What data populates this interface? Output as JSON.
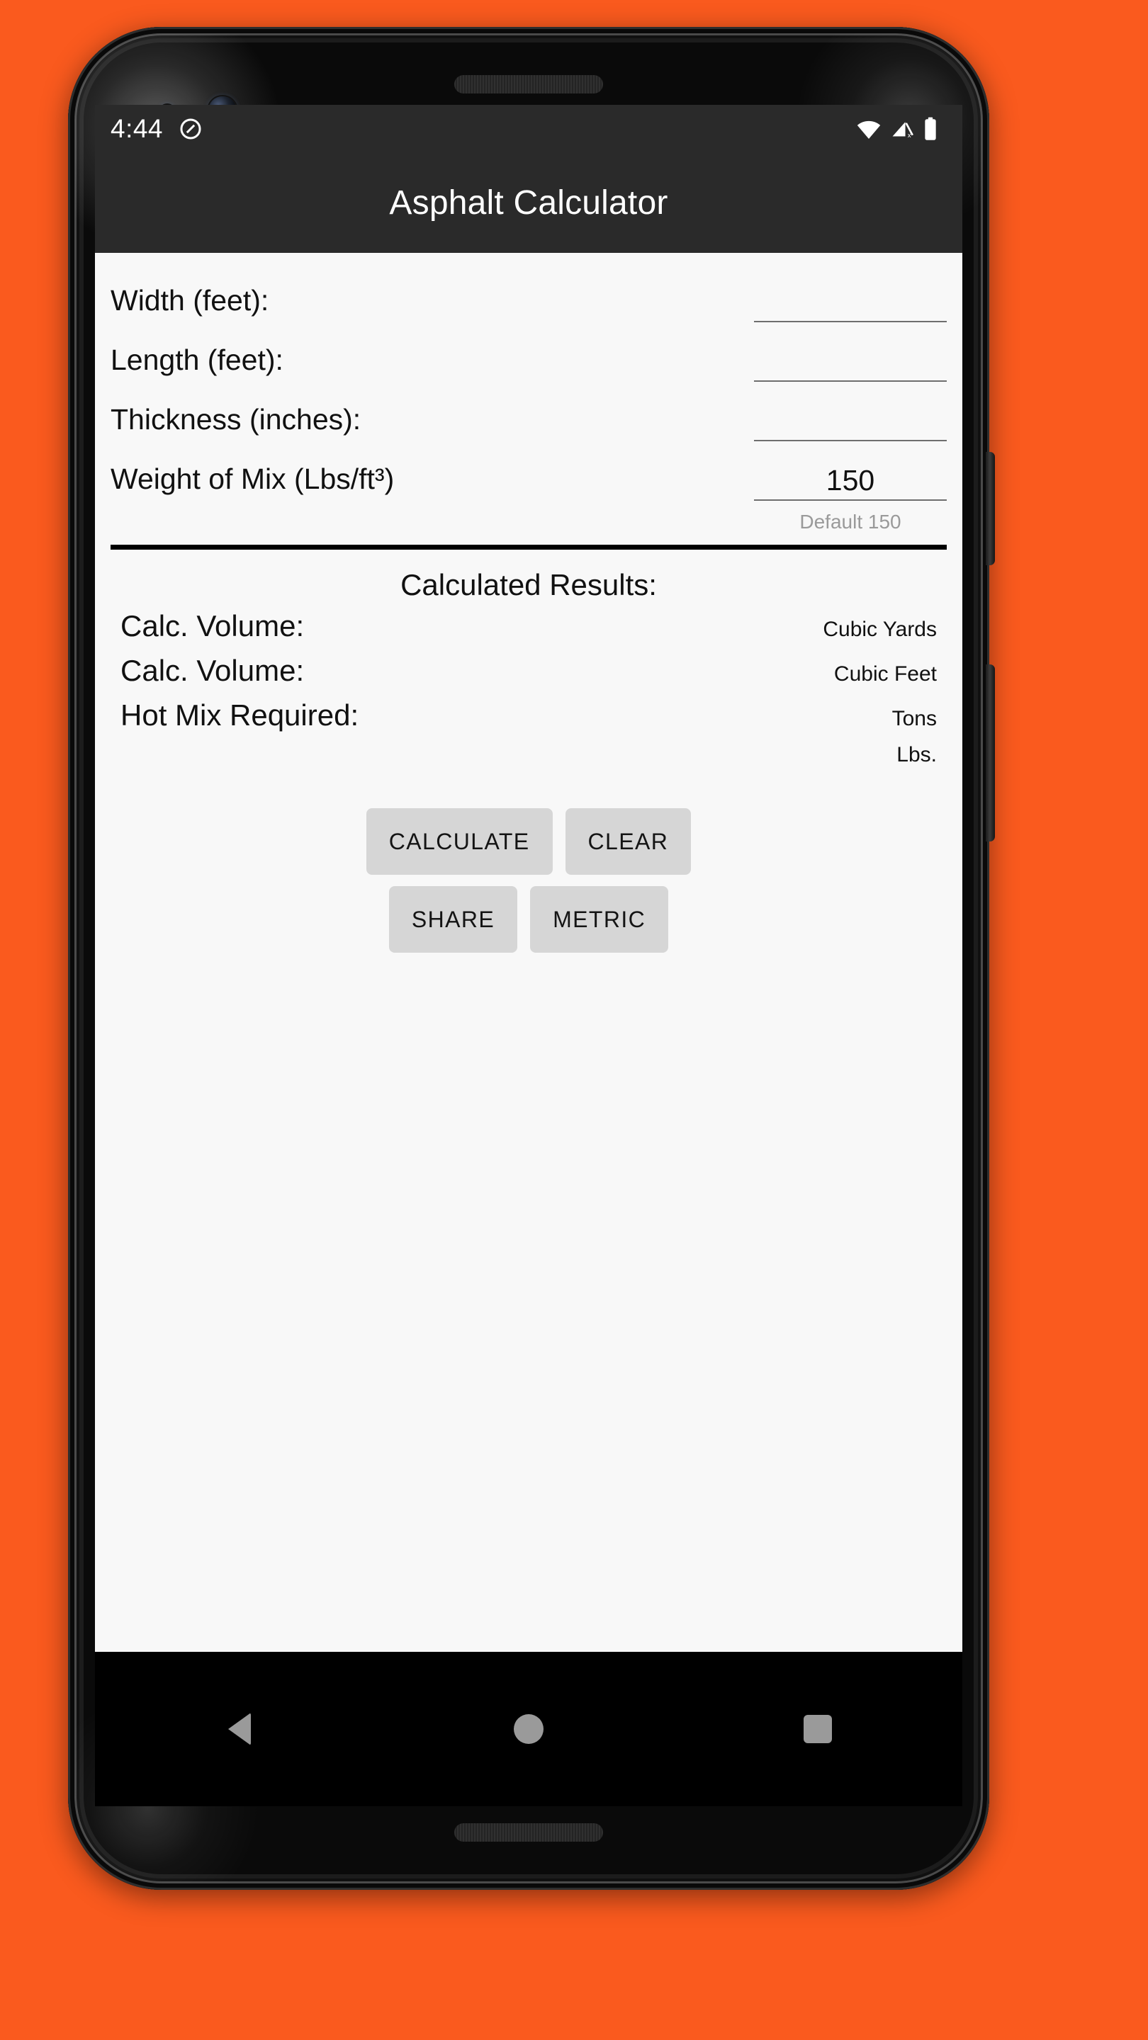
{
  "background_color": "#FA5A1E",
  "device": {
    "frame_color": "#0a0a0a",
    "icons": {
      "front_camera_small": "camera-lens-icon",
      "front_camera_large": "camera-lens-icon",
      "earpiece": "speaker-grille-icon",
      "bottom_speaker": "speaker-grille-icon",
      "power_button": "power-button",
      "volume_button": "volume-button"
    }
  },
  "statusbar": {
    "time": "4:44",
    "dnd_icon": "do-not-disturb-icon",
    "wifi_icon": "wifi-icon",
    "cellular_icon": "cellular-off-icon",
    "battery_icon": "battery-full-icon",
    "background_color": "#2a2a2a",
    "text_color": "#ffffff"
  },
  "appbar": {
    "title": "Asphalt Calculator",
    "background_color": "#2a2a2a",
    "text_color": "#ffffff"
  },
  "form": {
    "fields": [
      {
        "label": "Width (feet):",
        "value": "",
        "placeholder": ""
      },
      {
        "label": "Length (feet):",
        "value": "",
        "placeholder": ""
      },
      {
        "label": "Thickness (inches):",
        "value": "",
        "placeholder": ""
      },
      {
        "label": "Weight of Mix (Lbs/ft³)",
        "value": "150",
        "placeholder": ""
      }
    ],
    "hint": "Default 150",
    "hint_color": "#9a9a9a",
    "divider_color": "#000000"
  },
  "results": {
    "title": "Calculated Results:",
    "rows": [
      {
        "label": "Calc. Volume:",
        "unit": "Cubic Yards"
      },
      {
        "label": "Calc. Volume:",
        "unit": "Cubic Feet"
      },
      {
        "label": "Hot Mix Required:",
        "unit": "Tons"
      },
      {
        "label": "",
        "unit": "Lbs."
      }
    ]
  },
  "buttons": {
    "row1": [
      {
        "label": "CALCULATE"
      },
      {
        "label": "CLEAR"
      }
    ],
    "row2": [
      {
        "label": "SHARE"
      },
      {
        "label": "METRIC"
      }
    ],
    "background_color": "#D6D6D6",
    "text_color": "#141414"
  },
  "navbar": {
    "back_icon": "back-triangle-icon",
    "home_icon": "home-circle-icon",
    "recents_icon": "recents-square-icon",
    "background_color": "#000000",
    "icon_color": "#9a9a9a"
  }
}
